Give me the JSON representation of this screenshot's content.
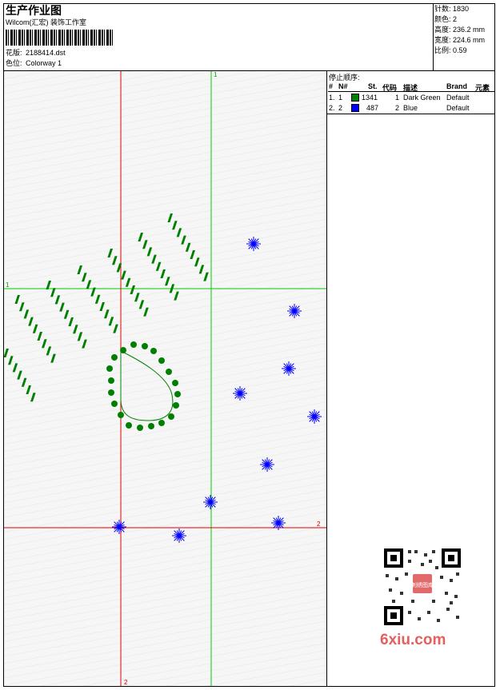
{
  "header": {
    "title": "生产作业图",
    "company": "Wilcom(汇宏) 装饰工作室",
    "design_label": "花版:",
    "design_file": "2188414.dst",
    "colorway_label": "色位:",
    "colorway": "Colorway 1"
  },
  "stats": [
    {
      "label": "针数:",
      "value": "1830"
    },
    {
      "label": "颜色:",
      "value": "2"
    },
    {
      "label": "高度:",
      "value": "236.2 mm"
    },
    {
      "label": "宽度:",
      "value": "224.6 mm"
    },
    {
      "label": "比例:",
      "value": "0.59"
    }
  ],
  "stop_sequence": {
    "title": "停止顺序:",
    "columns": [
      "#",
      "N#",
      "St.",
      "代码",
      "描述",
      "Brand",
      "元素"
    ],
    "rows": [
      {
        "num": "1.",
        "n": "1",
        "stitches": "1341",
        "code": "1",
        "desc": "Dark Green",
        "brand": "Default",
        "color": "#008000"
      },
      {
        "num": "2.",
        "n": "2",
        "stitches": "487",
        "code": "2",
        "desc": "Blue",
        "brand": "Default",
        "color": "#0000ff"
      }
    ]
  },
  "canvas": {
    "green_axis_label_top": "1",
    "green_axis_label_left": "1",
    "red_axis_label_right": "2",
    "red_axis_label_bottom": "2",
    "guide_green": "#00cc00",
    "guide_red": "#e00000",
    "stitch_green": "#008000",
    "stitch_blue": "#0000ff"
  },
  "watermark": {
    "site": "6xiu.com",
    "badge": "刺绣图库"
  }
}
